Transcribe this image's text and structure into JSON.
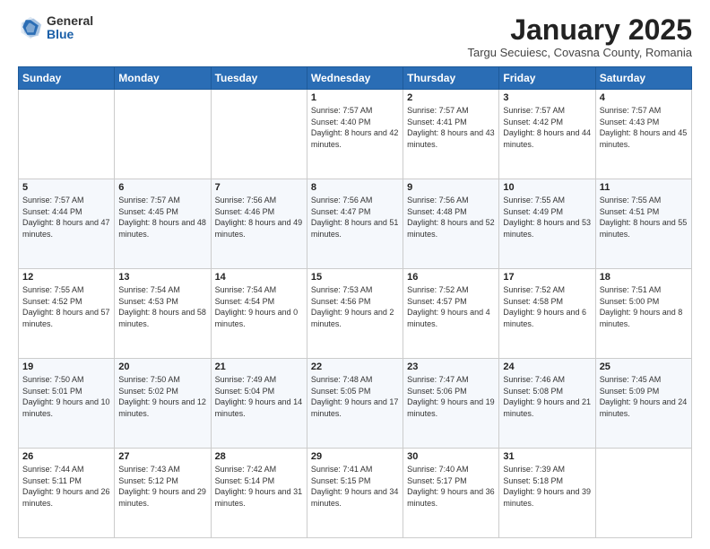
{
  "logo": {
    "general": "General",
    "blue": "Blue"
  },
  "title": "January 2025",
  "subtitle": "Targu Secuiesc, Covasna County, Romania",
  "days_header": [
    "Sunday",
    "Monday",
    "Tuesday",
    "Wednesday",
    "Thursday",
    "Friday",
    "Saturday"
  ],
  "weeks": [
    [
      {
        "day": "",
        "sunrise": "",
        "sunset": "",
        "daylight": ""
      },
      {
        "day": "",
        "sunrise": "",
        "sunset": "",
        "daylight": ""
      },
      {
        "day": "",
        "sunrise": "",
        "sunset": "",
        "daylight": ""
      },
      {
        "day": "1",
        "sunrise": "Sunrise: 7:57 AM",
        "sunset": "Sunset: 4:40 PM",
        "daylight": "Daylight: 8 hours and 42 minutes."
      },
      {
        "day": "2",
        "sunrise": "Sunrise: 7:57 AM",
        "sunset": "Sunset: 4:41 PM",
        "daylight": "Daylight: 8 hours and 43 minutes."
      },
      {
        "day": "3",
        "sunrise": "Sunrise: 7:57 AM",
        "sunset": "Sunset: 4:42 PM",
        "daylight": "Daylight: 8 hours and 44 minutes."
      },
      {
        "day": "4",
        "sunrise": "Sunrise: 7:57 AM",
        "sunset": "Sunset: 4:43 PM",
        "daylight": "Daylight: 8 hours and 45 minutes."
      }
    ],
    [
      {
        "day": "5",
        "sunrise": "Sunrise: 7:57 AM",
        "sunset": "Sunset: 4:44 PM",
        "daylight": "Daylight: 8 hours and 47 minutes."
      },
      {
        "day": "6",
        "sunrise": "Sunrise: 7:57 AM",
        "sunset": "Sunset: 4:45 PM",
        "daylight": "Daylight: 8 hours and 48 minutes."
      },
      {
        "day": "7",
        "sunrise": "Sunrise: 7:56 AM",
        "sunset": "Sunset: 4:46 PM",
        "daylight": "Daylight: 8 hours and 49 minutes."
      },
      {
        "day": "8",
        "sunrise": "Sunrise: 7:56 AM",
        "sunset": "Sunset: 4:47 PM",
        "daylight": "Daylight: 8 hours and 51 minutes."
      },
      {
        "day": "9",
        "sunrise": "Sunrise: 7:56 AM",
        "sunset": "Sunset: 4:48 PM",
        "daylight": "Daylight: 8 hours and 52 minutes."
      },
      {
        "day": "10",
        "sunrise": "Sunrise: 7:55 AM",
        "sunset": "Sunset: 4:49 PM",
        "daylight": "Daylight: 8 hours and 53 minutes."
      },
      {
        "day": "11",
        "sunrise": "Sunrise: 7:55 AM",
        "sunset": "Sunset: 4:51 PM",
        "daylight": "Daylight: 8 hours and 55 minutes."
      }
    ],
    [
      {
        "day": "12",
        "sunrise": "Sunrise: 7:55 AM",
        "sunset": "Sunset: 4:52 PM",
        "daylight": "Daylight: 8 hours and 57 minutes."
      },
      {
        "day": "13",
        "sunrise": "Sunrise: 7:54 AM",
        "sunset": "Sunset: 4:53 PM",
        "daylight": "Daylight: 8 hours and 58 minutes."
      },
      {
        "day": "14",
        "sunrise": "Sunrise: 7:54 AM",
        "sunset": "Sunset: 4:54 PM",
        "daylight": "Daylight: 9 hours and 0 minutes."
      },
      {
        "day": "15",
        "sunrise": "Sunrise: 7:53 AM",
        "sunset": "Sunset: 4:56 PM",
        "daylight": "Daylight: 9 hours and 2 minutes."
      },
      {
        "day": "16",
        "sunrise": "Sunrise: 7:52 AM",
        "sunset": "Sunset: 4:57 PM",
        "daylight": "Daylight: 9 hours and 4 minutes."
      },
      {
        "day": "17",
        "sunrise": "Sunrise: 7:52 AM",
        "sunset": "Sunset: 4:58 PM",
        "daylight": "Daylight: 9 hours and 6 minutes."
      },
      {
        "day": "18",
        "sunrise": "Sunrise: 7:51 AM",
        "sunset": "Sunset: 5:00 PM",
        "daylight": "Daylight: 9 hours and 8 minutes."
      }
    ],
    [
      {
        "day": "19",
        "sunrise": "Sunrise: 7:50 AM",
        "sunset": "Sunset: 5:01 PM",
        "daylight": "Daylight: 9 hours and 10 minutes."
      },
      {
        "day": "20",
        "sunrise": "Sunrise: 7:50 AM",
        "sunset": "Sunset: 5:02 PM",
        "daylight": "Daylight: 9 hours and 12 minutes."
      },
      {
        "day": "21",
        "sunrise": "Sunrise: 7:49 AM",
        "sunset": "Sunset: 5:04 PM",
        "daylight": "Daylight: 9 hours and 14 minutes."
      },
      {
        "day": "22",
        "sunrise": "Sunrise: 7:48 AM",
        "sunset": "Sunset: 5:05 PM",
        "daylight": "Daylight: 9 hours and 17 minutes."
      },
      {
        "day": "23",
        "sunrise": "Sunrise: 7:47 AM",
        "sunset": "Sunset: 5:06 PM",
        "daylight": "Daylight: 9 hours and 19 minutes."
      },
      {
        "day": "24",
        "sunrise": "Sunrise: 7:46 AM",
        "sunset": "Sunset: 5:08 PM",
        "daylight": "Daylight: 9 hours and 21 minutes."
      },
      {
        "day": "25",
        "sunrise": "Sunrise: 7:45 AM",
        "sunset": "Sunset: 5:09 PM",
        "daylight": "Daylight: 9 hours and 24 minutes."
      }
    ],
    [
      {
        "day": "26",
        "sunrise": "Sunrise: 7:44 AM",
        "sunset": "Sunset: 5:11 PM",
        "daylight": "Daylight: 9 hours and 26 minutes."
      },
      {
        "day": "27",
        "sunrise": "Sunrise: 7:43 AM",
        "sunset": "Sunset: 5:12 PM",
        "daylight": "Daylight: 9 hours and 29 minutes."
      },
      {
        "day": "28",
        "sunrise": "Sunrise: 7:42 AM",
        "sunset": "Sunset: 5:14 PM",
        "daylight": "Daylight: 9 hours and 31 minutes."
      },
      {
        "day": "29",
        "sunrise": "Sunrise: 7:41 AM",
        "sunset": "Sunset: 5:15 PM",
        "daylight": "Daylight: 9 hours and 34 minutes."
      },
      {
        "day": "30",
        "sunrise": "Sunrise: 7:40 AM",
        "sunset": "Sunset: 5:17 PM",
        "daylight": "Daylight: 9 hours and 36 minutes."
      },
      {
        "day": "31",
        "sunrise": "Sunrise: 7:39 AM",
        "sunset": "Sunset: 5:18 PM",
        "daylight": "Daylight: 9 hours and 39 minutes."
      },
      {
        "day": "",
        "sunrise": "",
        "sunset": "",
        "daylight": ""
      }
    ]
  ]
}
